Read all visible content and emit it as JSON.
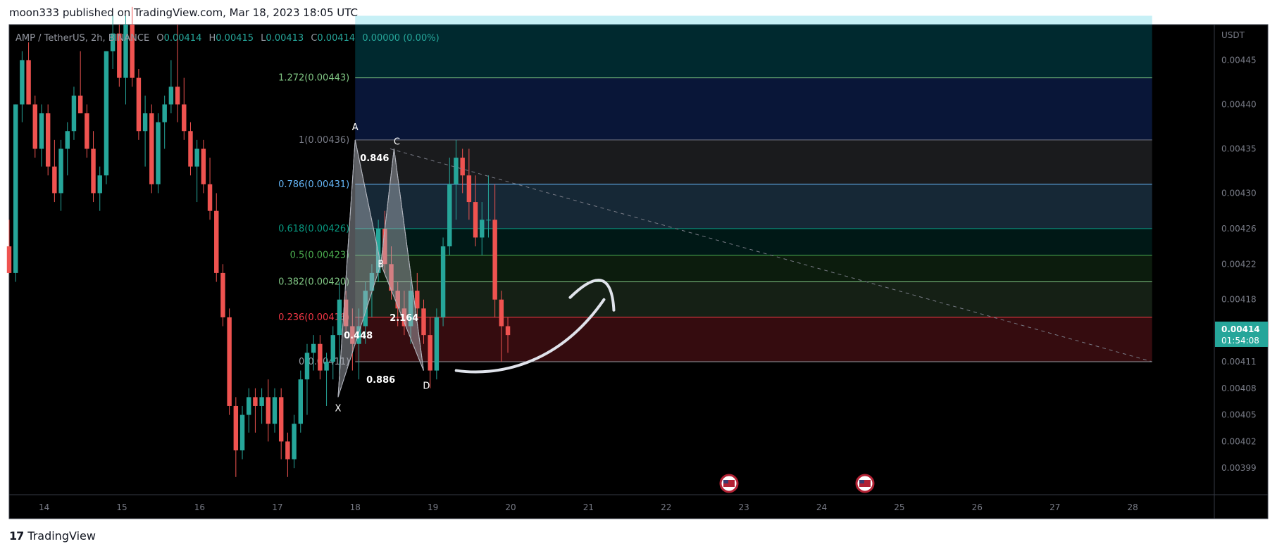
{
  "header": {
    "published": "moon333 published on TradingView.com, Mar 18, 2023 18:05 UTC"
  },
  "footer": {
    "brand": "TradingView",
    "logo_icon": "tradingview-logo-icon"
  },
  "legend": {
    "symbol": "AMP / TetherUS, 2h, BINANCE",
    "o_label": "O",
    "o": "0.00414",
    "h_label": "H",
    "h": "0.00415",
    "l_label": "L",
    "l": "0.00413",
    "c_label": "C",
    "c": "0.00414",
    "change": "0.00000 (0.00%)"
  },
  "price_badge": {
    "price": "0.00414",
    "countdown": "01:54:08",
    "color": "#26a69a"
  },
  "event_icons": [
    "us-flag-icon",
    "us-flag-icon"
  ],
  "chart_data": {
    "type": "candlestick",
    "currency": "USDT",
    "ylim": [
      0.00396,
      0.00449
    ],
    "y_ticks": [
      0.00445,
      0.0044,
      0.00435,
      0.0043,
      0.00426,
      0.00422,
      0.00418,
      0.00414,
      0.00411,
      0.00408,
      0.00405,
      0.00402,
      0.00399
    ],
    "y_tick_labels": [
      "0.00445",
      "0.00440",
      "0.00435",
      "0.00430",
      "0.00426",
      "0.00422",
      "0.00418",
      "0.00414",
      "0.00411",
      "0.00408",
      "0.00405",
      "0.00402",
      "0.00399"
    ],
    "x_ticks": [
      14,
      15,
      16,
      17,
      18,
      19,
      20,
      21,
      22,
      23,
      24,
      25,
      26,
      27,
      28
    ],
    "x_tick_labels": [
      "14",
      "15",
      "16",
      "17",
      "18",
      "19",
      "20",
      "21",
      "22",
      "23",
      "24",
      "25",
      "26",
      "27",
      "28"
    ],
    "xlim": [
      13.55,
      29.05
    ],
    "up_color": "#26a69a",
    "down_color": "#ef5350",
    "candle_step_days": 0.0833,
    "candles_start_day": 13.55,
    "candles": [
      [
        0.00424,
        0.00427,
        0.00421,
        0.00421
      ],
      [
        0.00421,
        0.0044,
        0.0042,
        0.0044
      ],
      [
        0.0044,
        0.00446,
        0.00438,
        0.00445
      ],
      [
        0.00445,
        0.00447,
        0.0044,
        0.0044
      ],
      [
        0.0044,
        0.00441,
        0.00434,
        0.00435
      ],
      [
        0.00435,
        0.0044,
        0.00433,
        0.00439
      ],
      [
        0.00439,
        0.0044,
        0.00432,
        0.00433
      ],
      [
        0.00433,
        0.00436,
        0.00429,
        0.0043
      ],
      [
        0.0043,
        0.00436,
        0.00428,
        0.00435
      ],
      [
        0.00435,
        0.00438,
        0.00432,
        0.00437
      ],
      [
        0.00437,
        0.00442,
        0.00436,
        0.00441
      ],
      [
        0.00441,
        0.00446,
        0.00439,
        0.00439
      ],
      [
        0.00439,
        0.0044,
        0.00434,
        0.00435
      ],
      [
        0.00435,
        0.00437,
        0.00429,
        0.0043
      ],
      [
        0.0043,
        0.00433,
        0.00428,
        0.00432
      ],
      [
        0.00432,
        0.00446,
        0.00431,
        0.00446
      ],
      [
        0.00446,
        0.0045,
        0.00444,
        0.00448
      ],
      [
        0.00448,
        0.00449,
        0.00442,
        0.00443
      ],
      [
        0.00443,
        0.0045,
        0.0044,
        0.00449
      ],
      [
        0.00449,
        0.00451,
        0.00442,
        0.00443
      ],
      [
        0.00443,
        0.00444,
        0.00436,
        0.00437
      ],
      [
        0.00437,
        0.00441,
        0.00433,
        0.00439
      ],
      [
        0.00439,
        0.0044,
        0.0043,
        0.00431
      ],
      [
        0.00431,
        0.00439,
        0.0043,
        0.00438
      ],
      [
        0.00438,
        0.00441,
        0.00435,
        0.0044
      ],
      [
        0.0044,
        0.00445,
        0.00439,
        0.00442
      ],
      [
        0.00442,
        0.00449,
        0.00438,
        0.0044
      ],
      [
        0.0044,
        0.00443,
        0.00436,
        0.00437
      ],
      [
        0.00437,
        0.00438,
        0.00432,
        0.00433
      ],
      [
        0.00433,
        0.00436,
        0.00429,
        0.00435
      ],
      [
        0.00435,
        0.00436,
        0.0043,
        0.00431
      ],
      [
        0.00431,
        0.00434,
        0.00427,
        0.00428
      ],
      [
        0.00428,
        0.0043,
        0.0042,
        0.00421
      ],
      [
        0.00421,
        0.00422,
        0.00415,
        0.00416
      ],
      [
        0.00416,
        0.00417,
        0.00405,
        0.00406
      ],
      [
        0.00406,
        0.00407,
        0.00398,
        0.00401
      ],
      [
        0.00401,
        0.00406,
        0.004,
        0.00405
      ],
      [
        0.00405,
        0.00408,
        0.00403,
        0.00407
      ],
      [
        0.00407,
        0.00408,
        0.00403,
        0.00406
      ],
      [
        0.00406,
        0.00408,
        0.00404,
        0.00407
      ],
      [
        0.00407,
        0.00409,
        0.00402,
        0.00404
      ],
      [
        0.00404,
        0.00408,
        0.00403,
        0.00407
      ],
      [
        0.00407,
        0.00408,
        0.004,
        0.00402
      ],
      [
        0.00402,
        0.00403,
        0.00398,
        0.004
      ],
      [
        0.004,
        0.00405,
        0.00399,
        0.00404
      ],
      [
        0.00404,
        0.0041,
        0.00403,
        0.00409
      ],
      [
        0.00409,
        0.00413,
        0.00405,
        0.00412
      ],
      [
        0.00412,
        0.00414,
        0.0041,
        0.00413
      ],
      [
        0.00413,
        0.00414,
        0.00409,
        0.0041
      ],
      [
        0.0041,
        0.00412,
        0.00406,
        0.00411
      ],
      [
        0.00411,
        0.00415,
        0.00409,
        0.00414
      ],
      [
        0.00414,
        0.0042,
        0.00409,
        0.00418
      ],
      [
        0.00418,
        0.00419,
        0.00414,
        0.00415
      ],
      [
        0.00415,
        0.00417,
        0.0041,
        0.00413
      ],
      [
        0.00413,
        0.00417,
        0.00409,
        0.00415
      ],
      [
        0.00415,
        0.0042,
        0.00413,
        0.00419
      ],
      [
        0.00419,
        0.00422,
        0.00416,
        0.00421
      ],
      [
        0.00421,
        0.00427,
        0.0042,
        0.00426
      ],
      [
        0.00426,
        0.00428,
        0.00421,
        0.00422
      ],
      [
        0.00422,
        0.00424,
        0.00418,
        0.00419
      ],
      [
        0.00419,
        0.0042,
        0.00415,
        0.00417
      ],
      [
        0.00417,
        0.00419,
        0.00414,
        0.00415
      ],
      [
        0.00415,
        0.0042,
        0.00413,
        0.00419
      ],
      [
        0.00419,
        0.00421,
        0.00416,
        0.00417
      ],
      [
        0.00417,
        0.00418,
        0.00413,
        0.00414
      ],
      [
        0.00414,
        0.00416,
        0.00408,
        0.0041
      ],
      [
        0.0041,
        0.00417,
        0.00409,
        0.00416
      ],
      [
        0.00416,
        0.00425,
        0.00415,
        0.00424
      ],
      [
        0.00424,
        0.00434,
        0.00423,
        0.00431
      ],
      [
        0.00431,
        0.00436,
        0.00427,
        0.00434
      ],
      [
        0.00434,
        0.00435,
        0.0043,
        0.00432
      ],
      [
        0.00432,
        0.00435,
        0.00427,
        0.00429
      ],
      [
        0.00429,
        0.00432,
        0.00424,
        0.00425
      ],
      [
        0.00425,
        0.00429,
        0.00423,
        0.00427
      ],
      [
        0.00427,
        0.00432,
        0.00425,
        0.00427
      ],
      [
        0.00427,
        0.00431,
        0.00416,
        0.00418
      ],
      [
        0.00418,
        0.00419,
        0.00411,
        0.00415
      ],
      [
        0.00415,
        0.00416,
        0.00412,
        0.00414
      ]
    ],
    "fib_levels": [
      {
        "ratio_label": "0(0.00411)",
        "value": 0.00411,
        "color": "#9598a1",
        "fill": "rgba(242,54,69,0.22)"
      },
      {
        "ratio_label": "0.236(0.00416)",
        "value": 0.00416,
        "color": "#f23645",
        "fill": "rgba(129,199,132,0.16)"
      },
      {
        "ratio_label": "0.382(0.00420)",
        "value": 0.0042,
        "color": "#81c784",
        "fill": "rgba(76,175,80,0.16)"
      },
      {
        "ratio_label": "0.5(0.00423)",
        "value": 0.00423,
        "color": "#4caf50",
        "fill": "rgba(0,150,136,0.16)"
      },
      {
        "ratio_label": "0.618(0.00426)",
        "value": 0.00426,
        "color": "#089981",
        "fill": "rgba(100,181,246,0.22)"
      },
      {
        "ratio_label": "0.786(0.00431)",
        "value": 0.00431,
        "color": "#64b5f6",
        "fill": "rgba(120,123,134,0.22)"
      },
      {
        "ratio_label": "1(0.00436)",
        "value": 0.00436,
        "color": "#787b86",
        "fill": "rgba(41,98,255,0.22)"
      },
      {
        "ratio_label": "1.272(0.00443)",
        "value": 0.00443,
        "color": "#81c784",
        "fill": "rgba(0,188,212,0.22)"
      }
    ],
    "fib_top": 0.0045,
    "fib_x_start": 18.0,
    "fib_x_end": 28.25,
    "pattern_points": [
      {
        "label": "X",
        "day": 17.78,
        "price": 0.00407
      },
      {
        "label": "A",
        "day": 18.0,
        "price": 0.00436
      },
      {
        "label": "B",
        "day": 18.33,
        "price": 0.00422
      },
      {
        "label": "C",
        "day": 18.5,
        "price": 0.00435
      },
      {
        "label": "D",
        "day": 18.88,
        "price": 0.0041
      }
    ],
    "pattern_ratios": [
      {
        "label": "0.846",
        "day": 18.25,
        "price": 0.00434
      },
      {
        "label": "0.448",
        "day": 18.04,
        "price": 0.00414
      },
      {
        "label": "2.164",
        "day": 18.63,
        "price": 0.00416
      },
      {
        "label": "0.886",
        "day": 18.33,
        "price": 0.00409
      }
    ],
    "trendline": {
      "from": [
        18.45,
        0.00435
      ],
      "to": [
        28.25,
        0.00411
      ]
    },
    "arrow_path_days_prices": [
      [
        19.3,
        0.0041
      ],
      [
        19.8,
        0.0041
      ],
      [
        20.6,
        0.00412
      ],
      [
        21.2,
        0.00418
      ]
    ]
  }
}
